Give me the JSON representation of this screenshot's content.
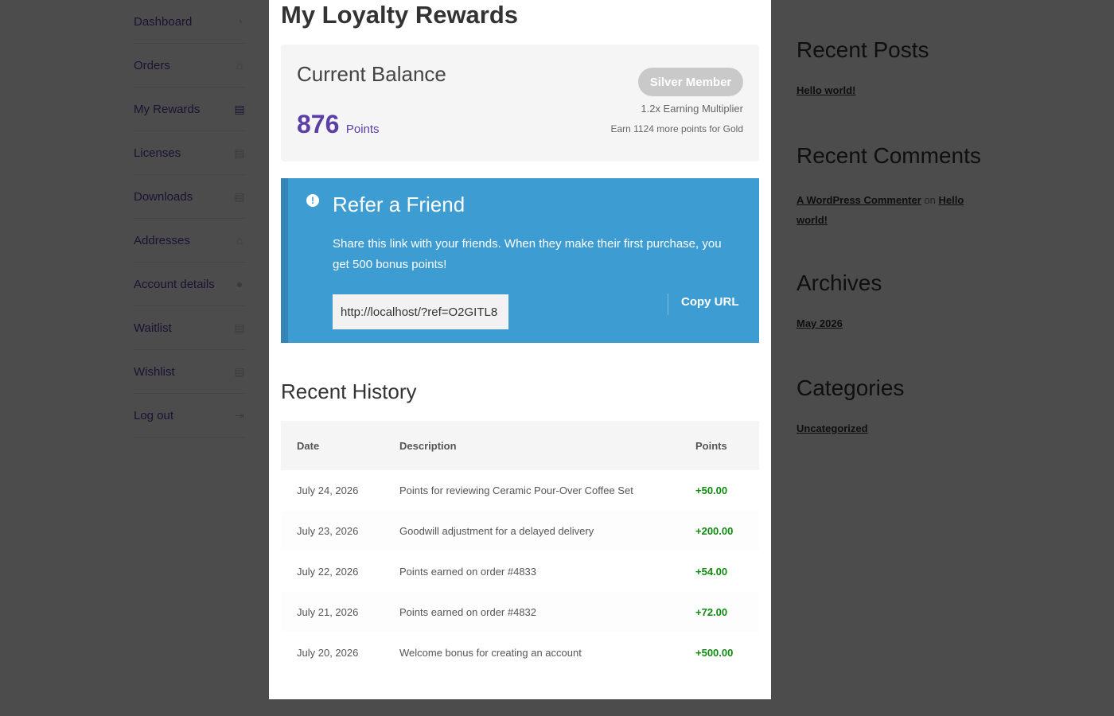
{
  "account_nav": [
    {
      "label": "Dashboard",
      "icon": "dashboard-icon",
      "glyph": "◔"
    },
    {
      "label": "Orders",
      "icon": "basket-icon",
      "glyph": "⌂"
    },
    {
      "label": "My Rewards",
      "icon": "document-icon",
      "glyph": "▤",
      "active": true
    },
    {
      "label": "Licenses",
      "icon": "file-icon",
      "glyph": "▤"
    },
    {
      "label": "Downloads",
      "icon": "file-download-icon",
      "glyph": "▤"
    },
    {
      "label": "Addresses",
      "icon": "home-icon",
      "glyph": "⌂"
    },
    {
      "label": "Account details",
      "icon": "user-icon",
      "glyph": "●"
    },
    {
      "label": "Waitlist",
      "icon": "file-icon",
      "glyph": "▤"
    },
    {
      "label": "Wishlist",
      "icon": "file-icon",
      "glyph": "▤"
    },
    {
      "label": "Log out",
      "icon": "sign-out-icon",
      "glyph": "⇥"
    }
  ],
  "page": {
    "title": "My Loyalty Rewards"
  },
  "balance": {
    "title": "Current Balance",
    "points": "876",
    "points_unit": "Points",
    "tier": "Silver Member",
    "multiplier": "1.2x Earning Multiplier",
    "next_tier": "Earn 1124 more points for Gold"
  },
  "referral": {
    "icon": "!",
    "title": "Refer a Friend",
    "description": "Share this link with your friends. When they make their first purchase, you get 500 bonus points!",
    "url": "http://localhost/?ref=O2GITL8",
    "copy_label": "Copy URL"
  },
  "history": {
    "title": "Recent History",
    "columns": [
      "Date",
      "Description",
      "Points"
    ],
    "rows": [
      {
        "date": "July 24, 2026",
        "description": "Points for reviewing Ceramic Pour-Over Coffee Set",
        "points": "+50.00"
      },
      {
        "date": "July 23, 2026",
        "description": "Goodwill adjustment for a delayed delivery",
        "points": "+200.00"
      },
      {
        "date": "July 22, 2026",
        "description": "Points earned on order #4833",
        "points": "+54.00"
      },
      {
        "date": "July 21, 2026",
        "description": "Points earned on order #4832",
        "points": "+72.00"
      },
      {
        "date": "July 20, 2026",
        "description": "Welcome bonus for creating an account",
        "points": "+500.00"
      }
    ]
  },
  "sidebar": {
    "recent_posts": {
      "title": "Recent Posts",
      "items": [
        "Hello world!"
      ]
    },
    "recent_comments": {
      "title": "Recent Comments",
      "author": "A WordPress Commenter",
      "connector": "on",
      "post": "Hello world!"
    },
    "archives": {
      "title": "Archives",
      "items": [
        "May 2026"
      ]
    },
    "categories": {
      "title": "Categories",
      "items": [
        "Uncategorized"
      ]
    }
  },
  "colors": {
    "accent": "#5b3ea8",
    "info_blue": "#3d9cd2",
    "positive_green": "#0f8a0f",
    "overlay": "rgba(0,0,0,0.7)"
  }
}
